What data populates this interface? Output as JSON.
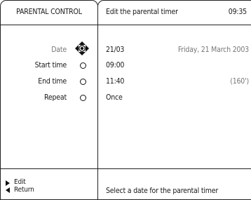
{
  "left_panel": {
    "title": "PARENTAL CONTROL",
    "items": [
      {
        "label": "Date",
        "selected": true
      },
      {
        "label": "Start time",
        "selected": false
      },
      {
        "label": "End time",
        "selected": false
      },
      {
        "label": "Repeat",
        "selected": false
      }
    ],
    "actions": [
      {
        "label": "Edit",
        "icon": "arrow-right-icon"
      },
      {
        "label": "Return",
        "icon": "arrow-left-icon"
      }
    ]
  },
  "right_panel": {
    "title": "Edit the parental timer",
    "clock": "09:35",
    "rows": [
      {
        "value": "21/03",
        "detail": "Friday, 21 March 2003"
      },
      {
        "value": "09:00",
        "detail": ""
      },
      {
        "value": "11:40",
        "detail": "(160')"
      },
      {
        "value": "Once",
        "detail": ""
      }
    ],
    "help": "Select a date for the parental timer"
  }
}
